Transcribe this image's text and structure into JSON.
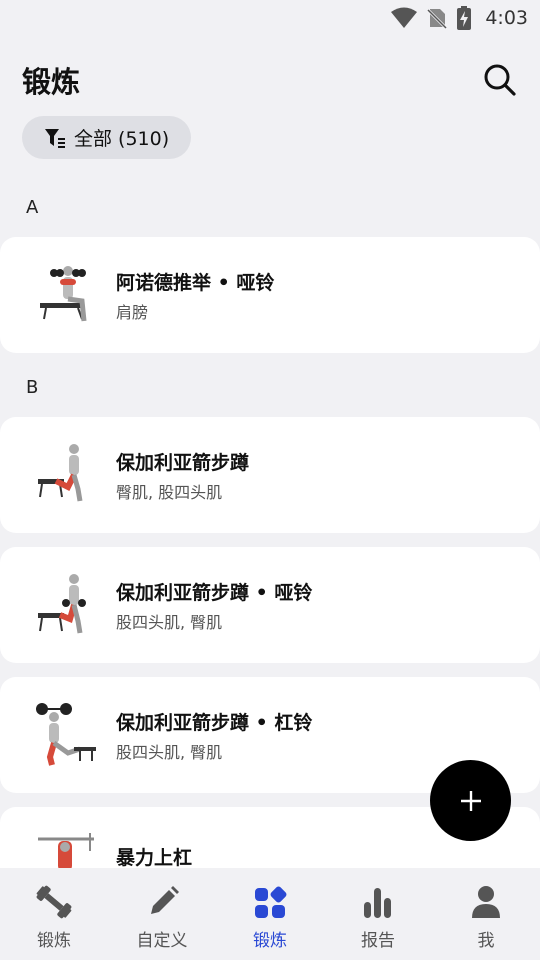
{
  "status_bar": {
    "time": "4:03"
  },
  "header": {
    "title": "锻炼"
  },
  "filter": {
    "label": "全部 (510)"
  },
  "sections": [
    {
      "letter": "A"
    },
    {
      "letter": "B"
    }
  ],
  "exercises": [
    {
      "title": "阿诺德推举 • 哑铃",
      "muscles": "肩膀"
    },
    {
      "title": "保加利亚箭步蹲",
      "muscles": "臀肌, 股四头肌"
    },
    {
      "title": "保加利亚箭步蹲 • 哑铃",
      "muscles": "股四头肌, 臀肌"
    },
    {
      "title": "保加利亚箭步蹲 • 杠铃",
      "muscles": "股四头肌, 臀肌"
    },
    {
      "title": "暴力上杠",
      "muscles": ""
    }
  ],
  "nav": [
    {
      "label": "锻炼",
      "icon": "dumbbell-icon"
    },
    {
      "label": "自定义",
      "icon": "pencil-icon"
    },
    {
      "label": "锻炼",
      "icon": "grid-icon",
      "active": true
    },
    {
      "label": "报告",
      "icon": "bar-chart-icon"
    },
    {
      "label": "我",
      "icon": "person-icon"
    }
  ],
  "colors": {
    "accent": "#2a49d4",
    "muscle_highlight": "#d64a3a",
    "background": "#f1f1f4"
  }
}
